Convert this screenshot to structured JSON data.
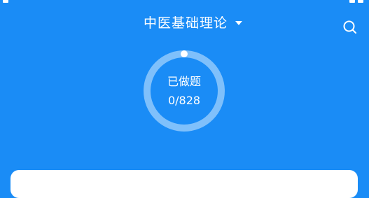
{
  "header": {
    "title": "中医基础理论"
  },
  "progress": {
    "label": "已做题",
    "count_text": "0/828",
    "done": 0,
    "total": 828
  },
  "icons": {
    "search": "search-icon",
    "dropdown": "caret-down-icon"
  },
  "colors": {
    "background": "#1a8cf6",
    "ring_track": "#7fc0fb",
    "text": "#ffffff"
  }
}
